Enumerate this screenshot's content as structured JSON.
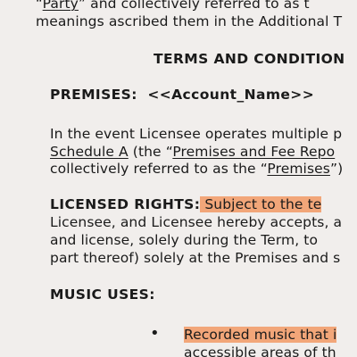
{
  "intro": {
    "line1_pre": "“",
    "line1_party": "Party",
    "line1_post": "” and collectively referred to as t",
    "line2": "meanings ascribed them in the Additional T"
  },
  "title": "TERMS AND CONDITION",
  "premises": {
    "label": "PREMISES:",
    "value": "<<Account_Name>>",
    "line1": "In the event Licensee operates multiple p",
    "line2_schedule": "Schedule A",
    "line2_mid": " (the “",
    "line2_premises_fee": "Premises and Fee Repo",
    "line3_pre": "collectively referred to as the “",
    "line3_premises": "Premises",
    "line3_post": "”)"
  },
  "licensed_rights": {
    "label": "LICENSED RIGHTS:",
    "highlight": " Subject to the te",
    "line2": "Licensee, and Licensee hereby accepts, a",
    "line3": "and license, solely during the Term, to",
    "line4": "part thereof) solely at the Premises and s"
  },
  "music_uses": {
    "label": "MUSIC USES:",
    "bullet": "•",
    "item1_highlight": "Recorded music that i",
    "item1_line2": "accessible areas of th"
  },
  "colors": {
    "highlight": "#f2a679",
    "paper": "#f1eeec",
    "text": "#1a1a1a"
  }
}
